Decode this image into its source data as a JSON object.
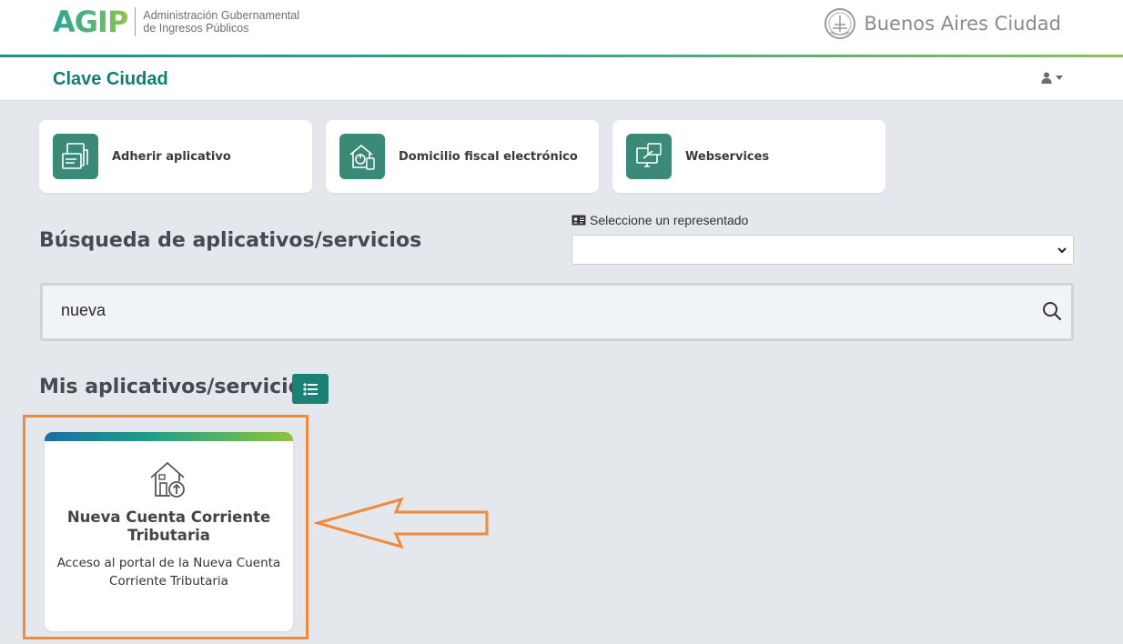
{
  "header": {
    "agip_logo": "AGIP",
    "agip_desc_line1": "Administración Gubernamental",
    "agip_desc_line2": "de Ingresos Públicos",
    "city_logo": "Buenos Aires Ciudad"
  },
  "subbar": {
    "title": "Clave Ciudad",
    "user_icon": "user-icon"
  },
  "quick_actions": [
    {
      "label": "Adherir aplicativo",
      "icon": "document-folder-icon"
    },
    {
      "label": "Domicilio fiscal electrónico",
      "icon": "house-power-icon"
    },
    {
      "label": "Webservices",
      "icon": "monitor-link-icon"
    }
  ],
  "search": {
    "title": "Búsqueda de aplicativos/servicios",
    "value": "nueva",
    "representado_label": "Seleccione un representado",
    "representado_value": ""
  },
  "my_apps": {
    "title": "Mis aplicativos/servicios",
    "apps": [
      {
        "title": "Nueva Cuenta Corriente Tributaria",
        "description": "Acceso al portal de la Nueva Cuenta Corriente Tributaria"
      }
    ]
  },
  "colors": {
    "accent": "#1a8275",
    "highlight": "#f08a3c"
  }
}
